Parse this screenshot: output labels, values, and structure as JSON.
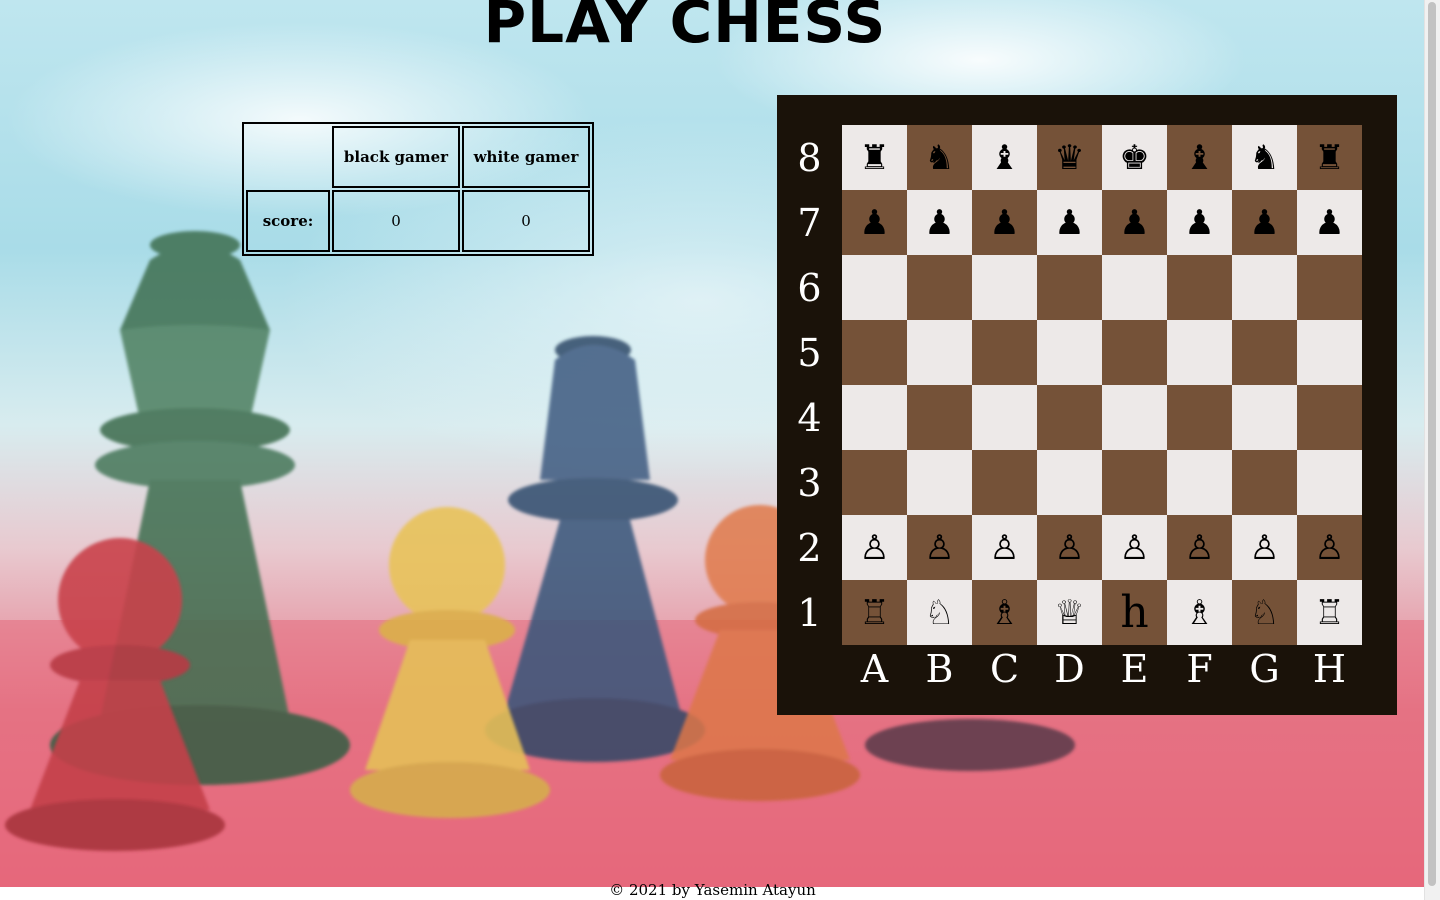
{
  "title": "PLAY CHESS",
  "score_table": {
    "black_header": "black gamer",
    "white_header": "white gamer",
    "row_label": "score:",
    "black_score": "0",
    "white_score": "0"
  },
  "board": {
    "ranks": [
      "8",
      "7",
      "6",
      "5",
      "4",
      "3",
      "2",
      "1"
    ],
    "files": [
      "A",
      "B",
      "C",
      "D",
      "E",
      "F",
      "G",
      "H"
    ],
    "light_color": "#ede9e8",
    "dark_color": "#755238",
    "frame_color": "#1a1209",
    "rows": [
      [
        "♜",
        "♞",
        "♝",
        "♛",
        "♚",
        "♝",
        "♞",
        "♜"
      ],
      [
        "♟",
        "♟",
        "♟",
        "♟",
        "♟",
        "♟",
        "♟",
        "♟"
      ],
      [
        "",
        "",
        "",
        "",
        "",
        "",
        "",
        ""
      ],
      [
        "",
        "",
        "",
        "",
        "",
        "",
        "",
        ""
      ],
      [
        "",
        "",
        "",
        "",
        "",
        "",
        "",
        ""
      ],
      [
        "",
        "",
        "",
        "",
        "",
        "",
        "",
        ""
      ],
      [
        "♙",
        "♙",
        "♙",
        "♙",
        "♙",
        "♙",
        "♙",
        "♙"
      ],
      [
        "♖",
        "♘",
        "♗",
        "♕",
        "h",
        "♗",
        "♘",
        "♖"
      ]
    ]
  },
  "footer": "© 2021 by Yasemin Atayun"
}
